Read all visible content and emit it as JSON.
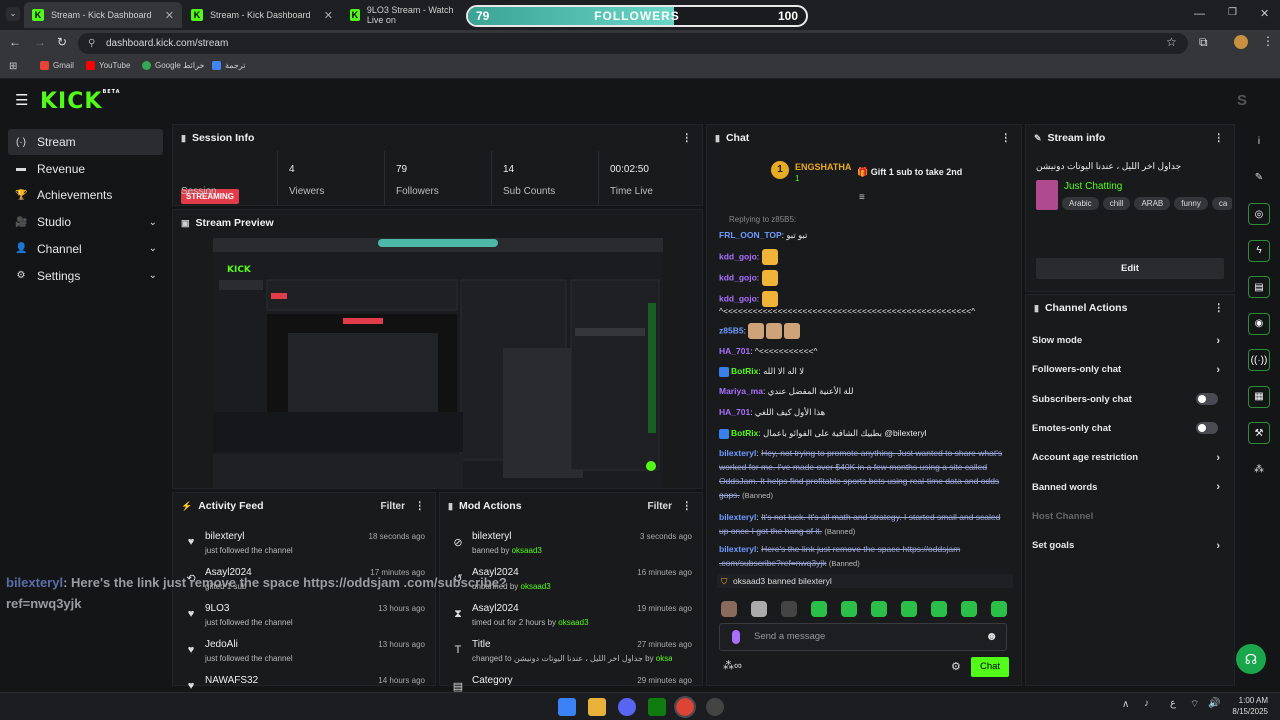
{
  "browser": {
    "tabs": [
      {
        "label": "Stream - Kick Dashboard"
      },
      {
        "label": "Stream - Kick Dashboard"
      },
      {
        "label": "9LO3 Stream - Watch Live on"
      }
    ],
    "url": "dashboard.kick.com/stream",
    "bookmarks": [
      "Gmail",
      "YouTube",
      "Google خرائط",
      "ترجمة"
    ]
  },
  "followers_goal": {
    "current": "79",
    "label": "FOLLOWERS",
    "target": "100",
    "progress": 0.79
  },
  "brand": {
    "logo": "KICK",
    "beta": "BETA",
    "user_initial": "S",
    "accent": "#53fc18"
  },
  "sidebar": [
    {
      "label": "Stream",
      "icon": "stream-icon",
      "glyph": "(·)",
      "active": true
    },
    {
      "label": "Revenue",
      "icon": "revenue-icon",
      "glyph": "▬"
    },
    {
      "label": "Achievements",
      "icon": "trophy-icon",
      "glyph": "🏆"
    },
    {
      "label": "Studio",
      "icon": "studio-icon",
      "glyph": "🎥",
      "chev": "⌄"
    },
    {
      "label": "Channel",
      "icon": "channel-icon",
      "glyph": "👤",
      "chev": "⌄"
    },
    {
      "label": "Settings",
      "icon": "gear-icon",
      "glyph": "⚙",
      "chev": "⌄"
    }
  ],
  "session": {
    "title": "Session Info",
    "badge": "STREAMING",
    "badge_label": "Session",
    "stats": [
      {
        "value": "4",
        "label": "Viewers"
      },
      {
        "value": "79",
        "label": "Followers"
      },
      {
        "value": "14",
        "label": "Sub Counts"
      },
      {
        "value": "00:02:50",
        "label": "Time Live"
      }
    ]
  },
  "preview": {
    "title": "Stream Preview"
  },
  "activity": {
    "title": "Activity Feed",
    "filter": "Filter",
    "items": [
      {
        "name": "bilexteryl",
        "desc": "just followed the channel",
        "time": "18 seconds ago"
      },
      {
        "name": "Asayl2024",
        "desc": "gifted 1 sub",
        "time": "17 minutes ago"
      },
      {
        "name": "9LO3",
        "desc": "just followed the channel",
        "time": "13 hours ago"
      },
      {
        "name": "JedoAli",
        "desc": "just followed the channel",
        "time": "13 hours ago"
      },
      {
        "name": "NAWAFS32",
        "desc": "",
        "time": "14 hours ago"
      }
    ]
  },
  "mod": {
    "title": "Mod Actions",
    "filter": "Filter",
    "items": [
      {
        "name": "bilexteryl",
        "desc": "banned by",
        "by": "oksaad3",
        "time": "3 seconds ago",
        "icon": "ban-icon",
        "glyph": "⊘"
      },
      {
        "name": "Asayl2024",
        "desc": "unbanned by",
        "by": "oksaad3",
        "time": "16 minutes ago",
        "icon": "undo-icon",
        "glyph": "↺"
      },
      {
        "name": "Asayl2024",
        "desc": "timed out for 2 hours by",
        "by": "oksaad3",
        "time": "19 minutes ago",
        "icon": "hourglass-icon",
        "glyph": "⧗"
      },
      {
        "name": "Title",
        "desc": "changed to جداول اخر الليل ، عندنا اليوتات دونيشن by",
        "by": "oksaad3",
        "time": "27 minutes ago",
        "icon": "title-icon",
        "glyph": "T"
      },
      {
        "name": "Category",
        "desc": "",
        "by": "",
        "time": "29 minutes ago",
        "icon": "category-icon",
        "glyph": "▤"
      }
    ]
  },
  "chat": {
    "title": "Chat",
    "pinned_user": "ENGSHATHA",
    "pinned_count": "1",
    "gift_text": "Gift 1 sub to take 2nd",
    "replying": "Replying to z85B5:",
    "messages": [
      {
        "user": "FRL_OON_TOP",
        "color": "blu",
        "text": "تبو تبو"
      },
      {
        "user": "kdd_gojo",
        "color": "pur",
        "text": ""
      },
      {
        "user": "kdd_gojo",
        "color": "pur",
        "text": ""
      },
      {
        "user": "kdd_gojo",
        "color": "pur",
        "text": ""
      },
      {
        "user": "",
        "color": "",
        "text": "^<<<<<<<<<<<<<<<<<<<<<<<<<<<<<<<<<<<<<<<<<<<<<<<<<<^"
      },
      {
        "user": "z85B5",
        "color": "blu",
        "text": ""
      },
      {
        "user": "HA_701",
        "color": "pur",
        "text": "^<<<<<<<<<<<^"
      },
      {
        "user": "BotRix",
        "color": "grn",
        "text": "لا اله الا الله"
      },
      {
        "user": "Mariya_ma",
        "color": "pur",
        "text": "للة الأعنية المفضل عندي"
      },
      {
        "user": "HA_701",
        "color": "pur",
        "text": "هذا الأول كيف اللغي"
      },
      {
        "user": "BotRix",
        "color": "grn",
        "text": "بطبيك الشافية على الفوائو باعمال @bilexteryl"
      },
      {
        "user": "bilexteryl",
        "color": "blu",
        "text": "Hey, not trying to promote anything. Just wanted to share what's worked for me. I've made over $40K in a few months using a site called OddsJam. It helps find profitable sports bets using real-time data and odds gaps.",
        "banned": "(Banned)"
      },
      {
        "user": "bilexteryl",
        "color": "blu",
        "text": "It's not luck. It's all math and strategy. I started small and scaled up once I got the hang of it.",
        "banned": "(Banned)"
      },
      {
        "user": "bilexteryl",
        "color": "blu",
        "text": "Here's the link just remove the space https://oddsjam .com/subscribe?ref=nwq3yjk",
        "banned": "(Banned)"
      }
    ],
    "mod_notice": "oksaad3 banned bilexteryl",
    "input_placeholder": "Send a message",
    "send_label": "Chat"
  },
  "stream_info": {
    "title": "Stream info",
    "stream_title": "جداول اخر الليل ، عندنا اليوتات دونيشن",
    "category": "Just Chatting",
    "tags": [
      "Arabic",
      "chill",
      "ARAB",
      "funny",
      "ca"
    ],
    "edit_label": "Edit"
  },
  "channel_actions": {
    "title": "Channel Actions",
    "items": [
      {
        "label": "Slow mode",
        "control": "chevron"
      },
      {
        "label": "Followers-only chat",
        "control": "chevron"
      },
      {
        "label": "Subscribers-only chat",
        "control": "toggle",
        "on": false
      },
      {
        "label": "Emotes-only chat",
        "control": "toggle",
        "on": false
      },
      {
        "label": "Account age restriction",
        "control": "chevron"
      },
      {
        "label": "Banned words",
        "control": "chevron"
      },
      {
        "label": "Host Channel",
        "control": "none",
        "disabled": true
      },
      {
        "label": "Set goals",
        "control": "chevron"
      }
    ]
  },
  "overlay": {
    "user": "bilexteryl",
    "text": ": Here's the link just remove the space https://oddsjam .com/subscribe?ref=nwq3yjk"
  },
  "taskbar": {
    "time": "1:00 AM",
    "date": "8/15/2025",
    "lang": "ع"
  }
}
